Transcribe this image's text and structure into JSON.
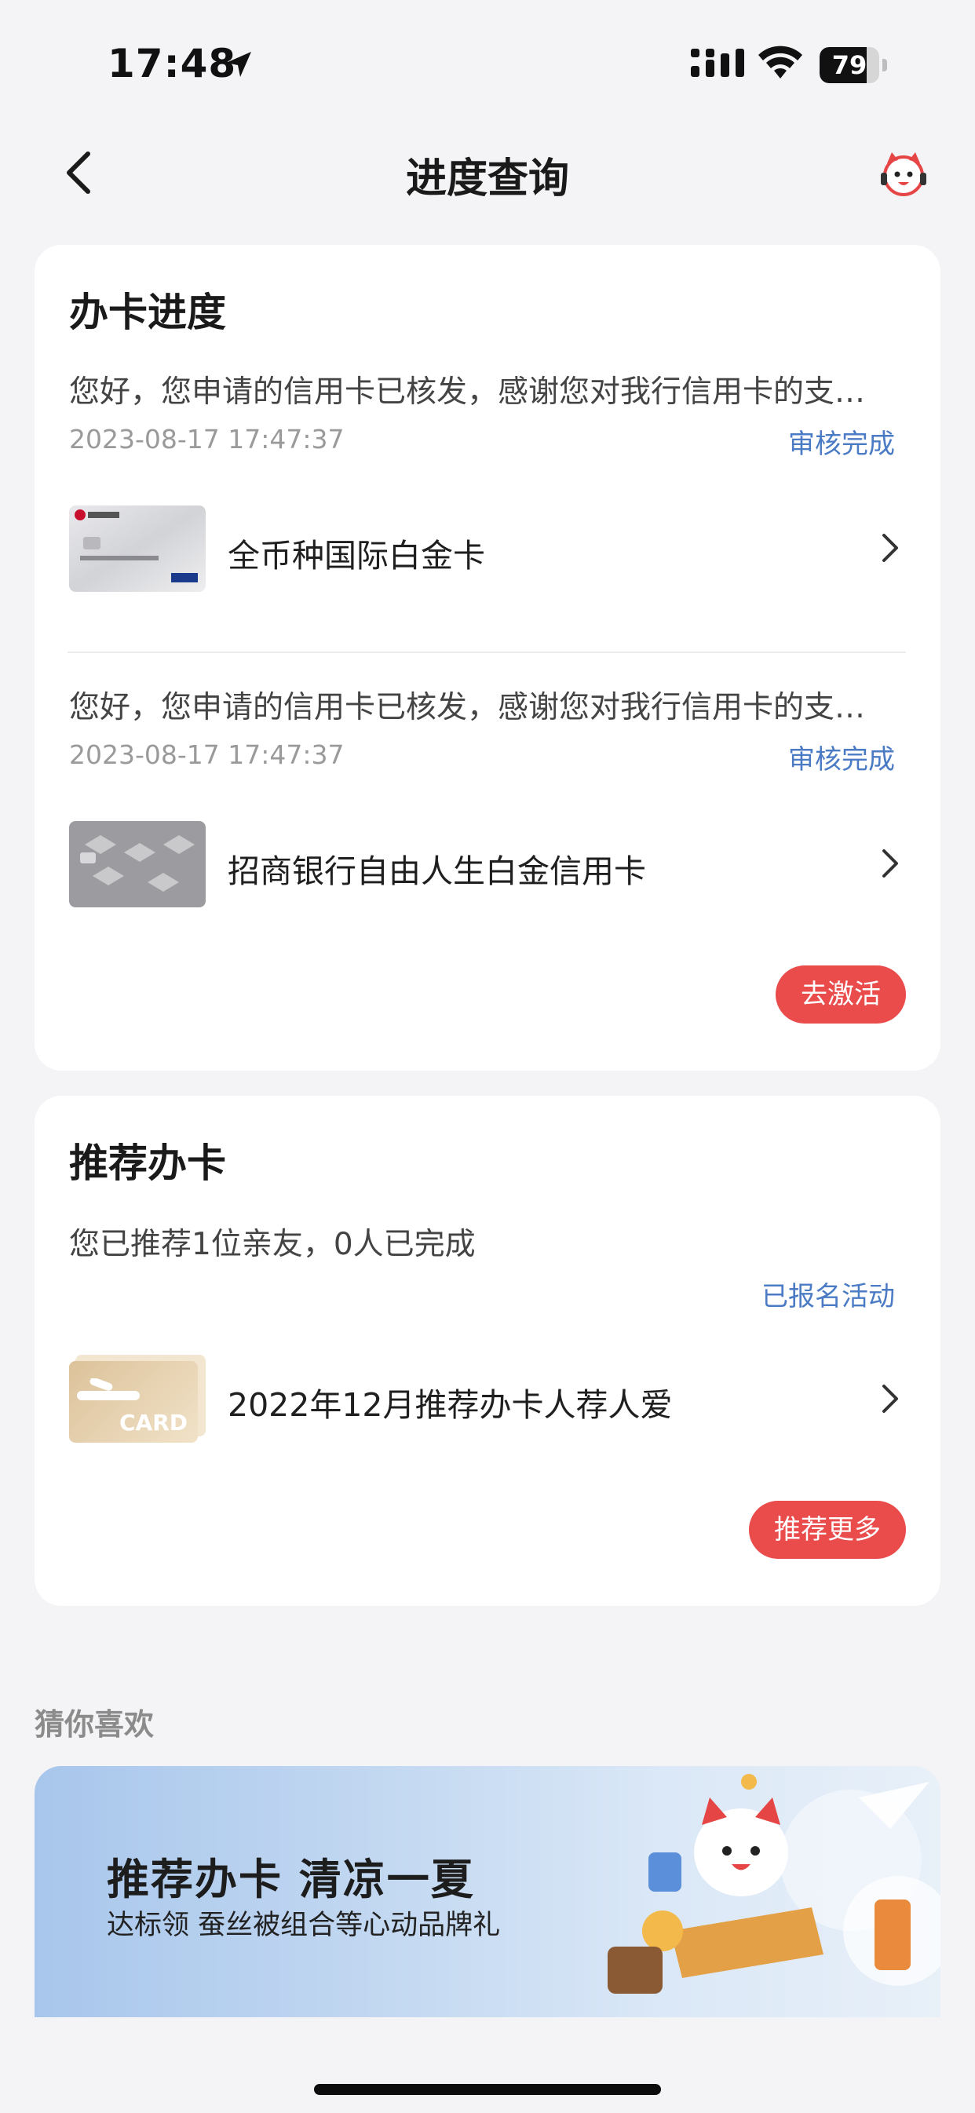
{
  "status_bar": {
    "time": "17:48",
    "battery": "79",
    "battery_level": 0.79
  },
  "nav": {
    "title": "进度查询"
  },
  "progress_section": {
    "title": "办卡进度",
    "items": [
      {
        "message": "您好，您申请的信用卡已核发，感谢您对我行信用卡的支…",
        "time": "2023-08-17 17:47:37",
        "status": "审核完成",
        "card_name": "全币种国际白金卡"
      },
      {
        "message": "您好，您申请的信用卡已核发，感谢您对我行信用卡的支…",
        "time": "2023-08-17 17:47:37",
        "status": "审核完成",
        "card_name": "招商银行自由人生白金信用卡"
      }
    ],
    "activate_button": "去激活"
  },
  "recommend_section": {
    "title": "推荐办卡",
    "summary": "您已推荐1位亲友，0人已完成",
    "registered_link": "已报名活动",
    "activity_name": "2022年12月推荐办卡人荐人爱",
    "card_badge": "CARD",
    "more_button": "推荐更多"
  },
  "guess": {
    "title": "猜你喜欢",
    "banner_title": "推荐办卡  清凉一夏",
    "banner_subtitle": "达标领 蚕丝被组合等心动品牌礼"
  },
  "colors": {
    "accent_red": "#ea4b4b",
    "link_blue": "#4b7bc4",
    "background": "#f4f4f6"
  }
}
